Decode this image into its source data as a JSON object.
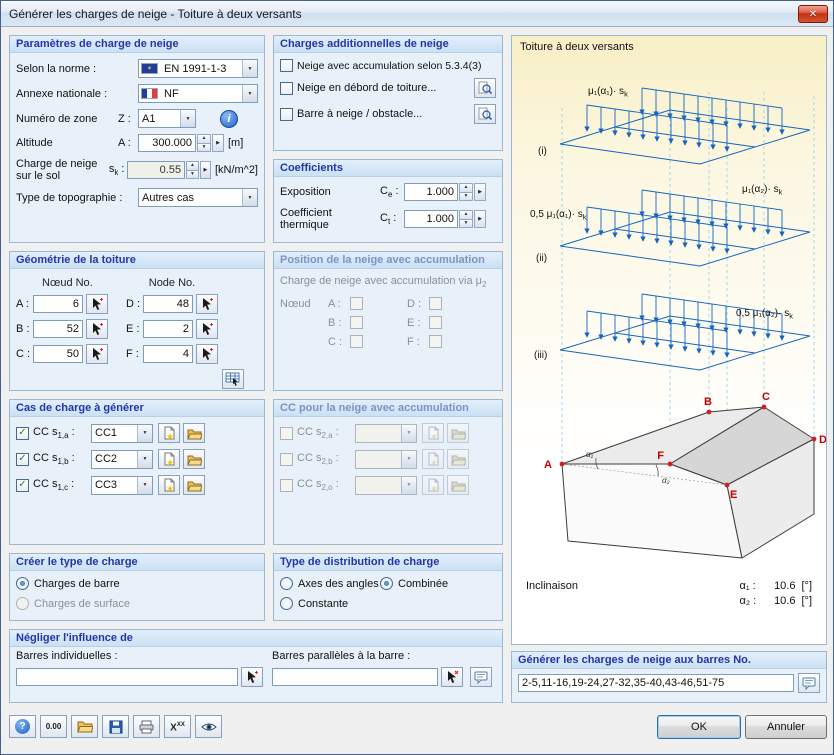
{
  "window": {
    "title": "Générer les charges de neige - Toiture à deux versants"
  },
  "icons": {
    "close": "✕",
    "dropdown": "▼",
    "spin_up": "▲",
    "spin_down": "▼",
    "detail": "▶",
    "help": "?",
    "info": "i",
    "units": "0.00",
    "formula_base": "X",
    "formula_sup": "XX",
    "check": "✓",
    "eu_star": "✶"
  },
  "params": {
    "title": "Paramètres de charge de neige",
    "norm_label": "Selon la norme :",
    "norm_value": "EN 1991-1-3",
    "annex_label": "Annexe nationale :",
    "annex_value": "NF",
    "zone_label": "Numéro de zone",
    "zone_sym": "Z :",
    "zone_value": "A1",
    "alt_label": "Altitude",
    "alt_sym": "A :",
    "alt_value": "300.000",
    "alt_unit": "[m]",
    "sk_label": "Charge de neige sur le sol",
    "sk_base": "s",
    "sk_sub": "k",
    "sk_colon": " :",
    "sk_value": "0.55",
    "sk_unit": "[kN/m^2]",
    "topo_label": "Type de topographie :",
    "topo_value": "Autres cas"
  },
  "geometry": {
    "title": "Géométrie de la toiture",
    "col1": "Nœud No.",
    "col2": "Node No.",
    "a_sym": "A :",
    "a_val": "6",
    "b_sym": "B :",
    "b_val": "52",
    "c_sym": "C :",
    "c_val": "50",
    "d_sym": "D :",
    "d_val": "48",
    "e_sym": "E :",
    "e_val": "2",
    "f_sym": "F :",
    "f_val": "4"
  },
  "load_cases": {
    "title": "Cas de charge à générer",
    "r1_base": "CC s",
    "r1_sub": "1,a",
    "r1_colon": " :",
    "r1_value": "CC1",
    "r2_base": "CC s",
    "r2_sub": "1,b",
    "r2_colon": " :",
    "r2_value": "CC2",
    "r3_base": "CC s",
    "r3_sub": "1,c",
    "r3_colon": " :",
    "r3_value": "CC3"
  },
  "load_type": {
    "title": "Créer le type de charge",
    "opt1": "Charges de barre",
    "opt2": "Charges de surface"
  },
  "neglect": {
    "title": "Négliger l'influence de",
    "individual_label": "Barres individuelles :",
    "individual_value": "",
    "parallel_label": "Barres parallèles à la barre :",
    "parallel_value": ""
  },
  "additional": {
    "title": "Charges additionnelles de neige",
    "opt1": "Neige avec accumulation selon 5.3.4(3)",
    "opt2": "Neige en débord de toiture...",
    "opt3": "Barre à neige / obstacle..."
  },
  "coefficients": {
    "title": "Coefficients",
    "exp_label": "Exposition",
    "exp_base": "C",
    "exp_sub": "e",
    "exp_colon": " :",
    "exp_value": "1.000",
    "th_label": "Coefficient thermique",
    "th_base": "C",
    "th_sub": "t",
    "th_colon": " :",
    "th_value": "1.000"
  },
  "drift_position": {
    "title": "Position de la neige avec accumulation",
    "subtitle_pre": "Charge de neige avec accumulation via μ",
    "subtitle_sub": "2",
    "node_label": "Nœud",
    "a": "A :",
    "b": "B :",
    "c": "C :",
    "d": "D :",
    "e": "E :",
    "f": "F :"
  },
  "drift_cases": {
    "title": "CC pour la neige avec accumulation",
    "r1_base": "CC s",
    "r1_sub": "2,a",
    "r1_colon": " :",
    "r1_value": "",
    "r2_base": "CC s",
    "r2_sub": "2,b",
    "r2_colon": " :",
    "r2_value": "",
    "r3_base": "CC s",
    "r3_sub": "2,o",
    "r3_colon": " :",
    "r3_value": ""
  },
  "distribution": {
    "title": "Type de distribution de charge",
    "opt1": "Axes des angles",
    "opt2": "Combinée",
    "opt3": "Constante"
  },
  "diagram": {
    "title": "Toiture à deux versants",
    "i": "(i)",
    "ii": "(ii)",
    "iii": "(iii)",
    "i_left_pre": "μ₁(α₁)· s",
    "i_left_sub": "k",
    "i_right_pre": "μ₁(α₂)· s",
    "i_right_sub": "k",
    "ii_left_pre": "0,5 μ₁(α₁)· s",
    "ii_left_sub": "k",
    "iii_right_pre": "0,5 μ₁(α₂)· s",
    "iii_right_sub": "k",
    "pt_a": "A",
    "pt_b": "B",
    "pt_c": "C",
    "pt_d": "D",
    "pt_e": "E",
    "pt_f": "F",
    "alpha1_small": "α₁",
    "alpha2_small": "α₂",
    "incl_label": "Inclinaison",
    "a1_sym": "α₁ :",
    "a1_value": "10.6",
    "a1_unit": "[°]",
    "a2_sym": "α₂ :",
    "a2_value": "10.6",
    "a2_unit": "[°]"
  },
  "generate": {
    "title": "Générer les charges de neige aux barres No.",
    "bars": "2-5,11-16,19-24,27-32,35-40,43-46,51-75"
  },
  "buttons": {
    "ok": "OK",
    "cancel": "Annuler"
  }
}
